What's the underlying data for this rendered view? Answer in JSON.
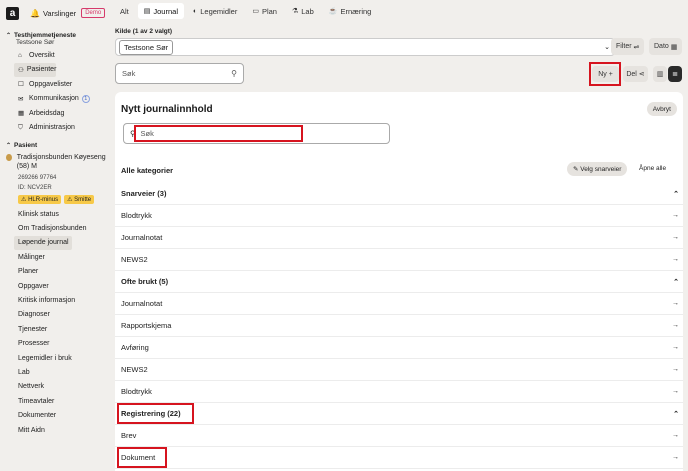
{
  "header": {
    "logo": "a",
    "varslinger": "Varslinger",
    "demo": "Demo"
  },
  "sidebar": {
    "org_title": "Testhjemmetjeneste",
    "org_sub": "Testsone Sør",
    "nav": [
      {
        "label": "Oversikt",
        "icon": "home-icon",
        "glyph": "⌂",
        "badge": ""
      },
      {
        "label": "Pasienter",
        "icon": "patients-icon",
        "glyph": "👥",
        "badge": ""
      },
      {
        "label": "Oppgavelister",
        "icon": "list-icon",
        "glyph": "☐",
        "badge": ""
      },
      {
        "label": "Kommunikasjon",
        "icon": "chat-icon",
        "glyph": "✉",
        "badge": "1"
      },
      {
        "label": "Arbeidsdag",
        "icon": "calendar-icon",
        "glyph": "▦",
        "badge": ""
      },
      {
        "label": "Administrasjon",
        "icon": "shield-icon",
        "glyph": "⛉",
        "badge": ""
      }
    ],
    "patient_section": "Pasient",
    "patient_name": "Tradisjonsbunden Køyeseng (58) M",
    "patient_id1": "269266 97764",
    "patient_id2": "ID: NCV2ER",
    "warn1": "HLR-minus",
    "warn2": "Smitte",
    "patient_nav": [
      "Klinisk status",
      "Om Tradisjonsbunden",
      "Løpende journal",
      "Målinger",
      "Planer",
      "Oppgaver",
      "Kritisk informasjon",
      "Diagnoser",
      "Tjenester",
      "Prosesser",
      "Legemidler i bruk",
      "Lab",
      "Nettverk",
      "Timeavtaler",
      "Dokumenter",
      "Mitt Aidn"
    ]
  },
  "tabs": [
    {
      "label": "Alt",
      "icon": ""
    },
    {
      "label": "Journal",
      "icon": "journal-icon"
    },
    {
      "label": "Legemidler",
      "icon": "pill-icon"
    },
    {
      "label": "Plan",
      "icon": "plan-icon"
    },
    {
      "label": "Lab",
      "icon": "lab-icon"
    },
    {
      "label": "Ernæring",
      "icon": "food-icon"
    }
  ],
  "kilde": {
    "label": "Kilde (1 av 2 valgt)",
    "chip": "Testsone Sør"
  },
  "filter_label": "Filter",
  "dato_label": "Dato",
  "search_placeholder": "Søk",
  "ny_label": "Ny",
  "del_label": "Del",
  "panel": {
    "title": "Nytt journalinnhold",
    "avbryt": "Avbryt",
    "search_placeholder": "Søk",
    "alle": "Alle kategorier",
    "velg": "Velg snarveier",
    "apne": "Åpne alle",
    "snarveier_head": "Snarveier (3)",
    "snarveier": [
      "Blodtrykk",
      "Journalnotat",
      "NEWS2"
    ],
    "ofte_head": "Ofte brukt (5)",
    "ofte": [
      "Journalnotat",
      "Rapportskjema",
      "Avføring",
      "NEWS2",
      "Blodtrykk"
    ],
    "reg_head": "Registrering (22)",
    "reg": [
      "Brev",
      "Dokument"
    ]
  }
}
